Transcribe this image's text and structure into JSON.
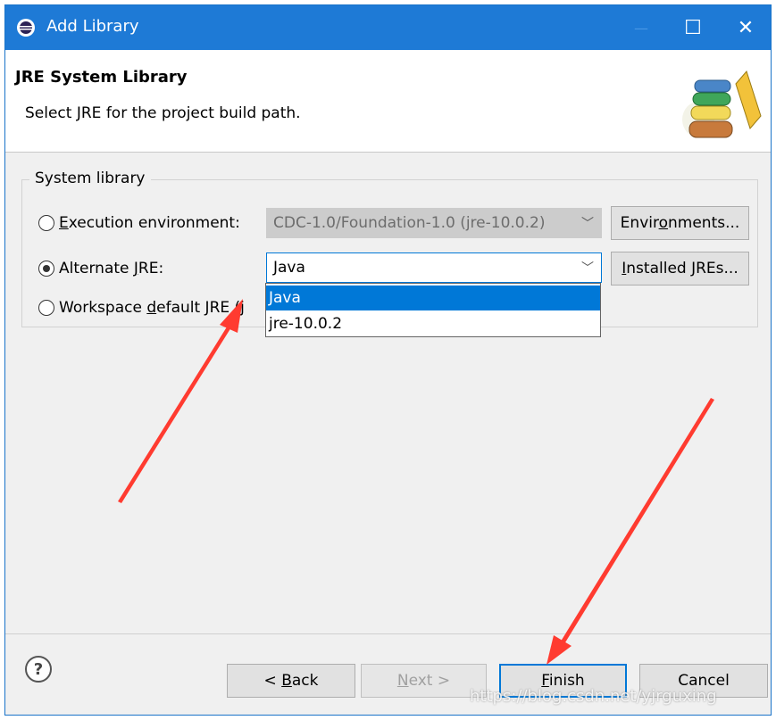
{
  "window": {
    "title": "Add Library",
    "controls": {
      "minimize": "—",
      "maximize": "☐",
      "close": "✕"
    }
  },
  "header": {
    "title": "JRE System Library",
    "description": "Select JRE for the project build path."
  },
  "group": {
    "label": "System library",
    "options": [
      {
        "label_pre": "",
        "mnemonic": "E",
        "label_post": "xecution environment:",
        "checked": false,
        "combo_value": "CDC-1.0/Foundation-1.0 (jre-10.0.2)",
        "combo_enabled": false,
        "button_pre": "Envir",
        "button_mnemonic": "o",
        "button_post": "nments..."
      },
      {
        "label_pre": "Alternate ",
        "mnemonic": "J",
        "label_post": "RE:",
        "checked": true,
        "combo_value": "Java",
        "combo_enabled": true,
        "button_pre": "",
        "button_mnemonic": "I",
        "button_post": "nstalled JREs..."
      },
      {
        "label_pre": "Workspace ",
        "mnemonic": "d",
        "label_post": "efault JRE (j",
        "checked": false
      }
    ]
  },
  "dropdown": {
    "items": [
      "Java",
      "jre-10.0.2"
    ],
    "selected": "Java"
  },
  "footer": {
    "help": "?",
    "back_pre": "< ",
    "back_mnemonic": "B",
    "back_post": "ack",
    "next_pre": "",
    "next_mnemonic": "N",
    "next_post": "ext >",
    "finish_pre": "",
    "finish_mnemonic": "F",
    "finish_post": "inish",
    "cancel": "Cancel"
  },
  "watermark": "https://blog.csdn.net/yjrguxing",
  "colors": {
    "titlebar": "#1e7ad6",
    "selection": "#0078d7",
    "annotation_arrow": "#ff3b30"
  }
}
